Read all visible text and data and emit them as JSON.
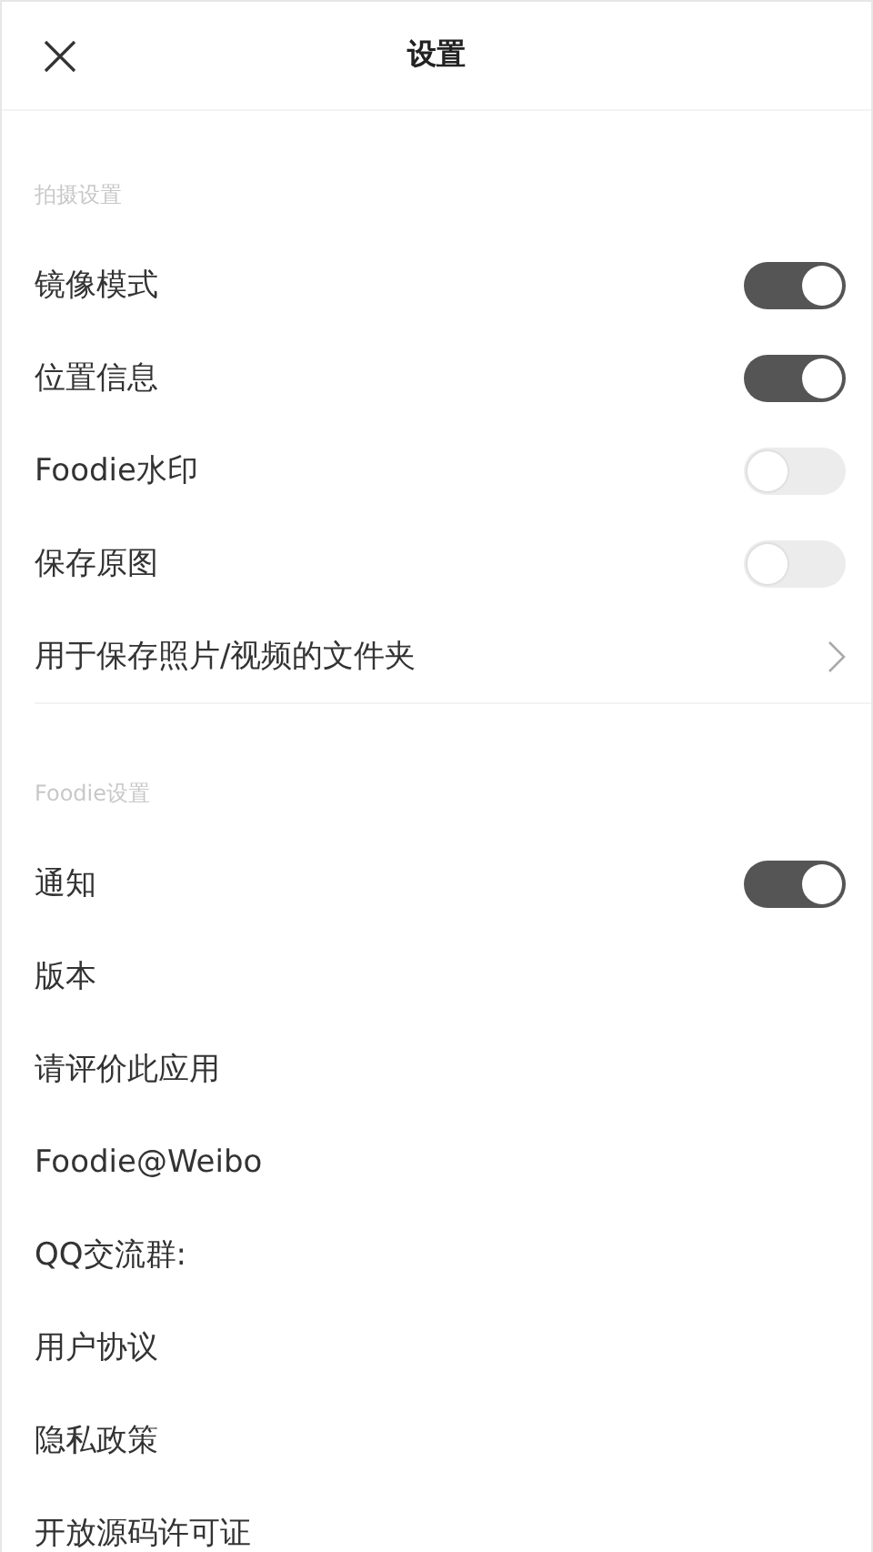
{
  "header": {
    "title": "设置"
  },
  "sections": [
    {
      "label": "拍摄设置",
      "rows": [
        {
          "kind": "toggle",
          "label": "镜像模式",
          "on": true
        },
        {
          "kind": "toggle",
          "label": "位置信息",
          "on": true
        },
        {
          "kind": "toggle",
          "label": "Foodie水印",
          "on": false
        },
        {
          "kind": "toggle",
          "label": "保存原图",
          "on": false
        },
        {
          "kind": "link",
          "label": "用于保存照片/视频的文件夹"
        }
      ]
    },
    {
      "label": "Foodie设置",
      "rows": [
        {
          "kind": "toggle",
          "label": "通知",
          "on": true
        },
        {
          "kind": "plain",
          "label": "版本"
        },
        {
          "kind": "plain",
          "label": "请评价此应用"
        },
        {
          "kind": "plain",
          "label": "Foodie@Weibo"
        },
        {
          "kind": "plain",
          "label": "QQ交流群:"
        },
        {
          "kind": "plain",
          "label": "用户协议"
        },
        {
          "kind": "plain",
          "label": "隐私政策"
        },
        {
          "kind": "plain",
          "label": "开放源码许可证"
        }
      ]
    }
  ]
}
